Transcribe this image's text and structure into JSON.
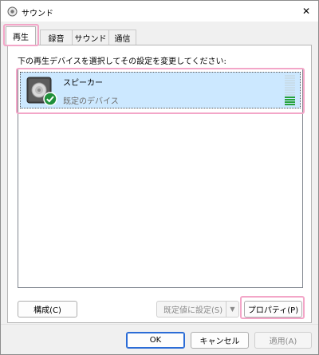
{
  "window": {
    "title": "サウンド",
    "close_glyph": "✕"
  },
  "tabs": [
    {
      "label": "再生",
      "active": true
    },
    {
      "label": "録音",
      "active": false
    },
    {
      "label": "サウンド",
      "active": false
    },
    {
      "label": "通信",
      "active": false
    }
  ],
  "panel": {
    "instruction": "下の再生デバイスを選択してその設定を変更してください:",
    "devices": [
      {
        "name": "スピーカー",
        "status": "既定のデバイス",
        "icon": "speaker-icon",
        "badge": "default-check-icon",
        "meter_level": 0.3,
        "selected": true
      }
    ]
  },
  "buttons": {
    "configure": "構成(C)",
    "set_default": "既定値に設定(S)",
    "properties": "プロパティ(P)",
    "ok": "OK",
    "cancel": "キャンセル",
    "apply": "適用(A)"
  },
  "colors": {
    "selection": "#cce8ff",
    "highlight": "#f3a6c8",
    "check": "#1f8f3a",
    "meter_on": "#26a23c"
  }
}
